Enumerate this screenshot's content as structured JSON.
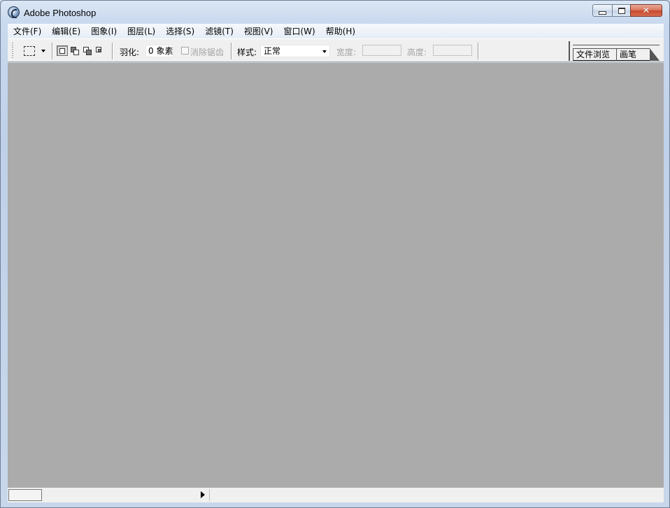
{
  "window": {
    "title": "Adobe Photoshop"
  },
  "window_controls": {
    "minimize_icon": "minimize-icon",
    "maximize_icon": "maximize-icon",
    "close_glyph": "✕"
  },
  "menu": [
    {
      "label": "文件(F)"
    },
    {
      "label": "编辑(E)"
    },
    {
      "label": "图象(I)"
    },
    {
      "label": "图层(L)"
    },
    {
      "label": "选择(S)"
    },
    {
      "label": "滤镜(T)"
    },
    {
      "label": "视图(V)"
    },
    {
      "label": "窗口(W)"
    },
    {
      "label": "帮助(H)"
    }
  ],
  "options": {
    "tool_icon": "rectangular-marquee-icon",
    "feather_label": "羽化:",
    "feather_value": "0 象素",
    "antialias_label": "消除锯齿",
    "antialias_checked": false,
    "style_label": "样式:",
    "style_value": "正常",
    "width_label": "宽度:",
    "height_label": "高度:"
  },
  "palette_well": {
    "tabs": [
      {
        "label": "文件浏览"
      },
      {
        "label": "画笔"
      }
    ]
  },
  "colors": {
    "workspace": "#ababab",
    "toolbar": "#f0f0f0",
    "close_button": "#c7482c"
  }
}
